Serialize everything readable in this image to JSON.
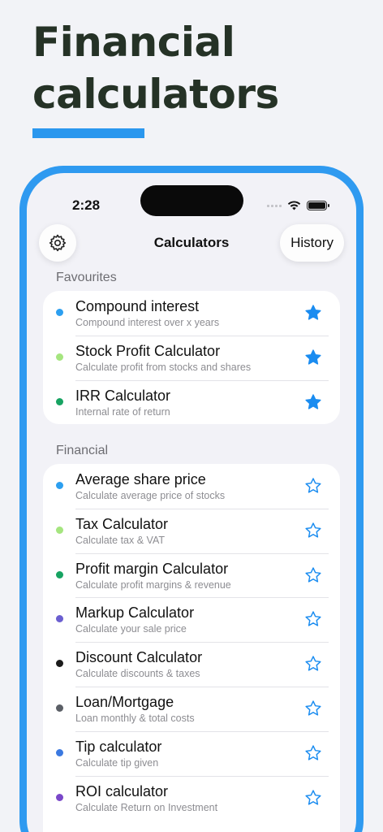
{
  "headline": {
    "line1": "Financial",
    "line2": "calculators"
  },
  "status_bar": {
    "time": "2:28"
  },
  "nav": {
    "title": "Calculators",
    "history_label": "History"
  },
  "sections": {
    "favourites": "Favourites",
    "financial": "Financial"
  },
  "favourites": [
    {
      "title": "Compound interest",
      "subtitle": "Compound interest over x years",
      "color": "#2c9ff0",
      "starred": true
    },
    {
      "title": "Stock Profit Calculator",
      "subtitle": "Calculate profit from stocks and shares",
      "color": "#a5e57f",
      "starred": true
    },
    {
      "title": "IRR Calculator",
      "subtitle": "Internal rate of return",
      "color": "#17a362",
      "starred": true
    }
  ],
  "financial": [
    {
      "title": "Average share price",
      "subtitle": "Calculate average price of stocks",
      "color": "#2c9ff0",
      "starred": false
    },
    {
      "title": "Tax Calculator",
      "subtitle": "Calculate tax & VAT",
      "color": "#a5e57f",
      "starred": false
    },
    {
      "title": "Profit margin Calculator",
      "subtitle": "Calculate profit margins & revenue",
      "color": "#17a362",
      "starred": false
    },
    {
      "title": "Markup Calculator",
      "subtitle": "Calculate your sale price",
      "color": "#6b5fd0",
      "starred": false
    },
    {
      "title": "Discount Calculator",
      "subtitle": "Calculate discounts & taxes",
      "color": "#1b1b1b",
      "starred": false
    },
    {
      "title": "Loan/Mortgage",
      "subtitle": "Loan monthly & total costs",
      "color": "#5b5f66",
      "starred": false
    },
    {
      "title": "Tip calculator",
      "subtitle": "Calculate tip given",
      "color": "#3b79e0",
      "starred": false
    },
    {
      "title": "ROI calculator",
      "subtitle": "Calculate Return on Investment",
      "color": "#7a48c9",
      "starred": false
    }
  ],
  "colors": {
    "accent": "#2f9af0",
    "star": "#1a8cf0"
  },
  "icons": {
    "settings": "gear-icon",
    "favourite_on": "star-filled-icon",
    "favourite_off": "star-outline-icon"
  }
}
